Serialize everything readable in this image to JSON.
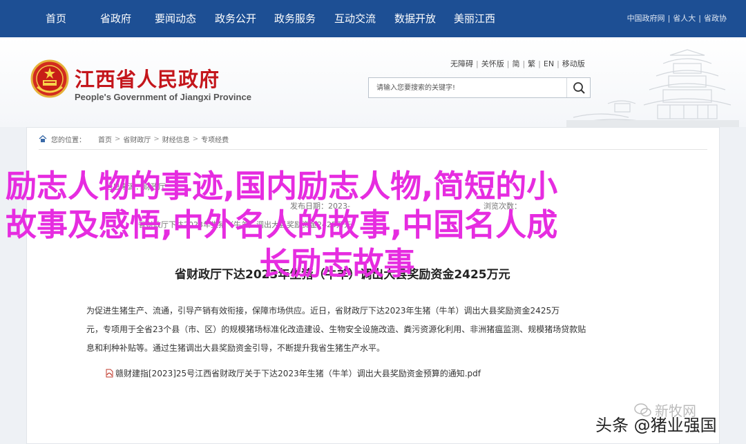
{
  "topnav": {
    "items": [
      "首页",
      "省政府",
      "要闻动态",
      "政务公开",
      "政务服务",
      "互动交流",
      "数据开放",
      "美丽江西"
    ],
    "links": [
      "中国政府网",
      "省人大",
      "省政协"
    ]
  },
  "header": {
    "title": "江西省人民政府",
    "subtitle": "People's Government of Jiangxi Province",
    "utility_links": [
      "无障碍",
      "关怀版",
      "简",
      "繁",
      "EN",
      "移动版"
    ],
    "search_placeholder": "请输入您要搜索的关键字!"
  },
  "breadcrumb": {
    "label": "您的位置：",
    "items": [
      "首页",
      "省财政厅",
      "财经信息",
      "专项经费"
    ]
  },
  "meta": {
    "info1": "信息来源：财政厅",
    "info2": "发布日期：2023-",
    "info3": "浏览次数：",
    "title_partial": "省财政厅下达2023年生猪（牛羊）调出大县奖励资金2425万元"
  },
  "article": {
    "title": "省财政厅下达2023年生猪（牛羊）调出大县奖励资金2425万元",
    "paragraph_lines": [
      "为促进生猪生产、流通，引导产销有效衔接，保障市场供应。近日，省财政厅下达2023年生猪（牛羊）调出大县奖励资金2425万",
      "元，专项用于全省23个县（市、区）的规模猪场标准化改造建设、生物安全设施改造、粪污资源化利用、非洲猪瘟监测、规模猪场贷款贴",
      "息和利种补贴等。通过生猪调出大县奖励资金引导，不断提升我省生猪生产水平。"
    ],
    "attachment": "赣财建指[2023]25号江西省财政厅关于下达2023年生猪（牛羊）调出大县奖励资金预算的通知.pdf"
  },
  "overlay": {
    "line1": "励志人物的事迹,国内励志人物,简短的小",
    "line2": "故事及感悟,中外名人的故事,中国名人成",
    "line3": "长励志故事"
  },
  "watermark": {
    "logo_text": "新牧网",
    "source": "头条 @猪业强国"
  },
  "colors": {
    "nav_bg": "#1d4f94",
    "title_red": "#c4161c",
    "overlay_magenta": "#e62ce0"
  },
  "icons": {
    "search": "search-icon",
    "pdf": "pdf-icon",
    "home": "home-icon",
    "emblem": "national-emblem-icon"
  }
}
